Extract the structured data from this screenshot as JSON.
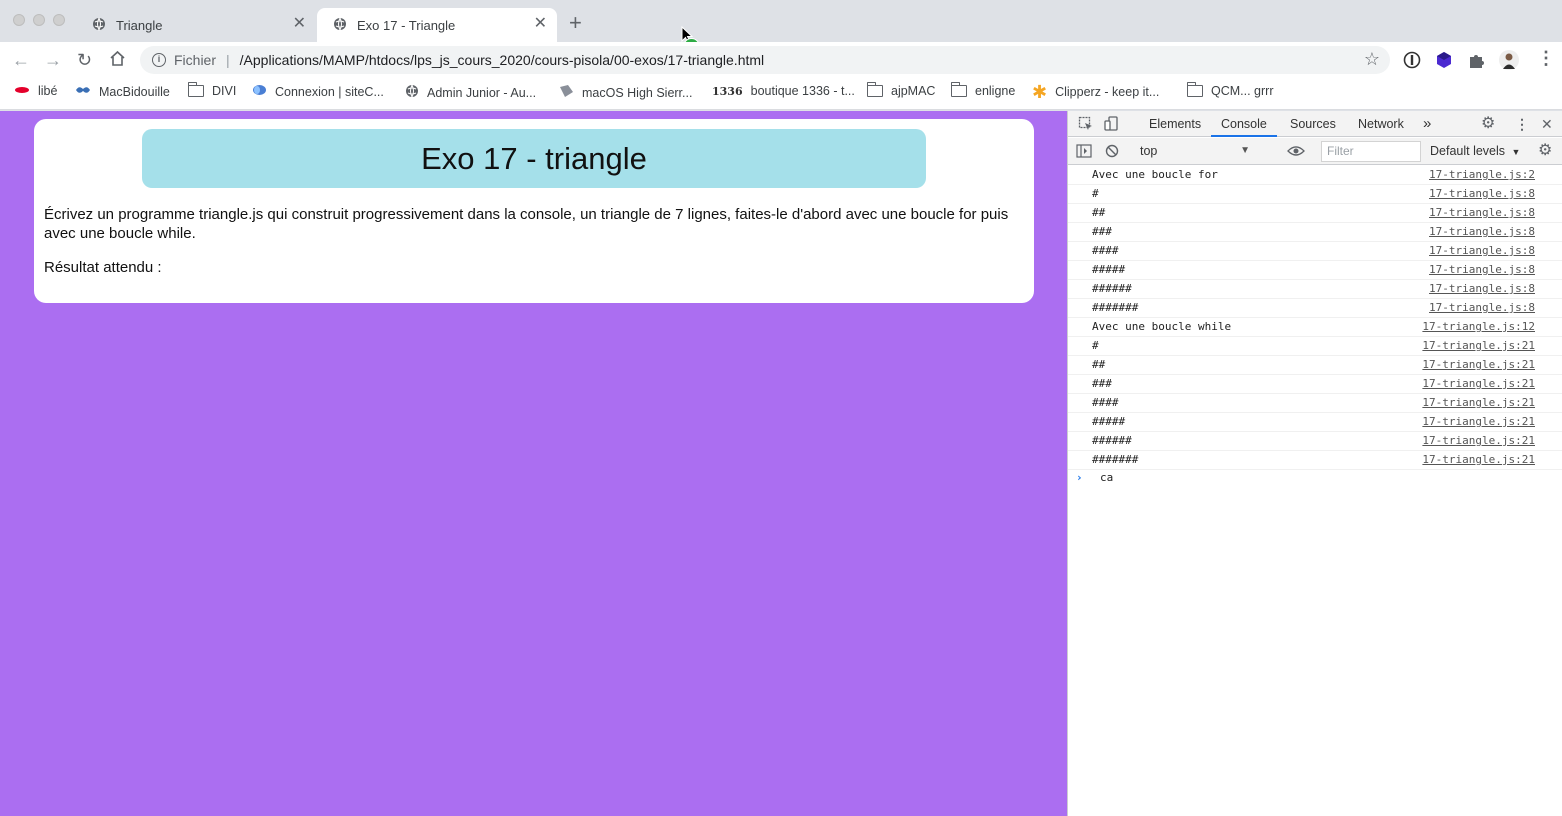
{
  "tabs": [
    {
      "title": "Triangle",
      "active": false
    },
    {
      "title": "Exo 17 - Triangle",
      "active": true
    }
  ],
  "toolbar": {
    "scheme": "Fichier",
    "url": "/Applications/MAMP/htdocs/lps_js_cours_2020/cours-pisola/00-exos/17-triangle.html"
  },
  "bookmarks": [
    {
      "label": "libé",
      "icon": "libe-icon"
    },
    {
      "label": "MacBidouille",
      "icon": "macbidouille-icon"
    },
    {
      "label": "DIVI",
      "icon": "folder-icon"
    },
    {
      "label": "Connexion | siteC...",
      "icon": "site-icon"
    },
    {
      "label": "Admin Junior - Au...",
      "icon": "globe-icon"
    },
    {
      "label": "macOS High Sierr...",
      "icon": "macos-icon"
    },
    {
      "label": "boutique 1336 - t...",
      "icon": "boutique-icon"
    },
    {
      "label": "ajpMAC",
      "icon": "folder-icon"
    },
    {
      "label": "enligne",
      "icon": "folder-icon"
    },
    {
      "label": "Clipperz - keep it...",
      "icon": "star-icon"
    },
    {
      "label": "QCM... grrr",
      "icon": "folder-icon"
    }
  ],
  "page": {
    "heading": "Exo 17 - triangle",
    "description": "Écrivez un programme triangle.js qui construit progressivement dans la console, un triangle de 7 lignes, faites-le d'abord avec une boucle for puis avec une boucle while.",
    "result_label": "Résultat attendu :",
    "background": "#ab6ef1",
    "heading_bg": "#a5e0ea"
  },
  "devtools": {
    "tabs": [
      "Elements",
      "Console",
      "Sources",
      "Network"
    ],
    "active_tab": "Console",
    "more": "»",
    "context": "top",
    "filter_placeholder": "Filter",
    "levels": "Default levels",
    "console_lines": [
      {
        "msg": "Avec une boucle for",
        "src": "17-triangle.js:2"
      },
      {
        "msg": "#",
        "src": "17-triangle.js:8"
      },
      {
        "msg": "##",
        "src": "17-triangle.js:8"
      },
      {
        "msg": "###",
        "src": "17-triangle.js:8"
      },
      {
        "msg": "####",
        "src": "17-triangle.js:8"
      },
      {
        "msg": "#####",
        "src": "17-triangle.js:8"
      },
      {
        "msg": "######",
        "src": "17-triangle.js:8"
      },
      {
        "msg": "#######",
        "src": "17-triangle.js:8"
      },
      {
        "msg": "Avec une boucle while",
        "src": "17-triangle.js:12"
      },
      {
        "msg": "#",
        "src": "17-triangle.js:21"
      },
      {
        "msg": "##",
        "src": "17-triangle.js:21"
      },
      {
        "msg": "###",
        "src": "17-triangle.js:21"
      },
      {
        "msg": "####",
        "src": "17-triangle.js:21"
      },
      {
        "msg": "#####",
        "src": "17-triangle.js:21"
      },
      {
        "msg": "######",
        "src": "17-triangle.js:21"
      },
      {
        "msg": "#######",
        "src": "17-triangle.js:21"
      }
    ],
    "prompt_input": "ca"
  }
}
